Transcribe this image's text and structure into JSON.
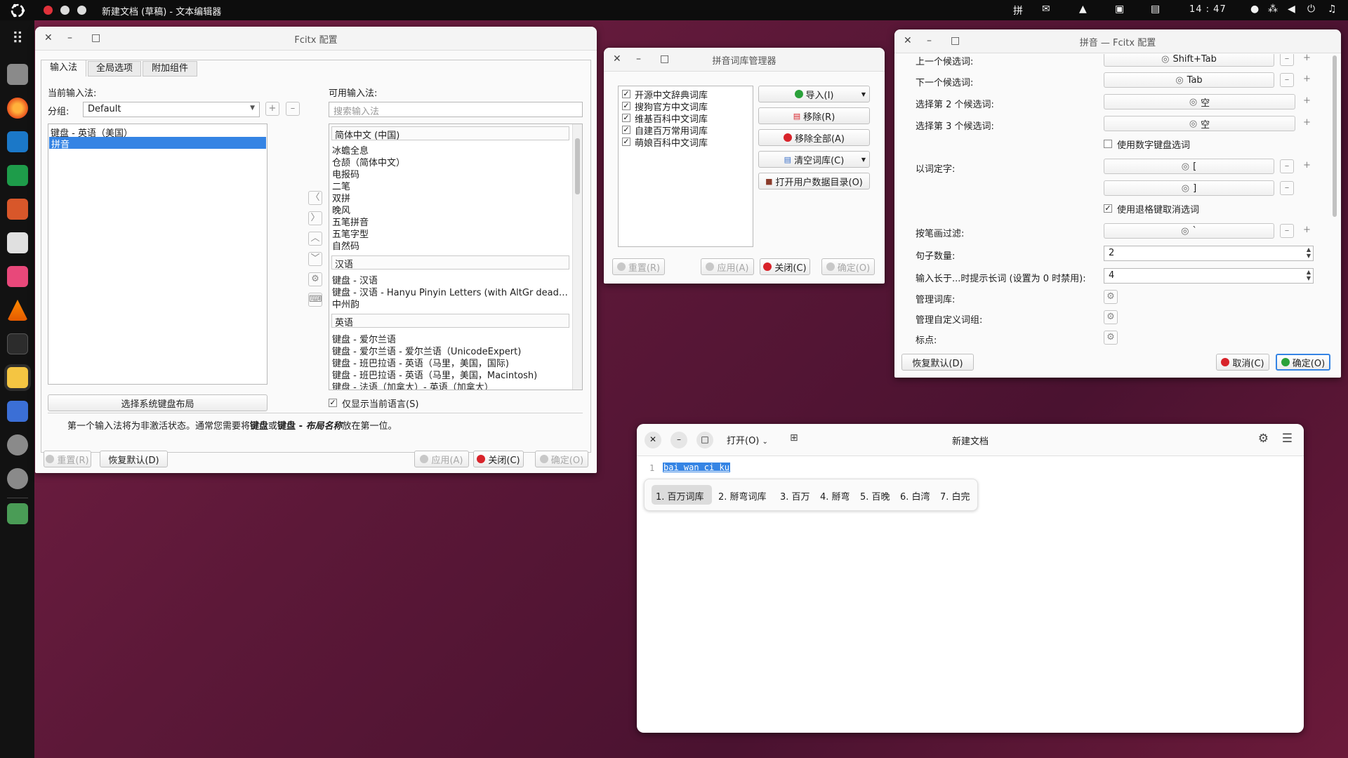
{
  "topbar": {
    "title": "新建文档 (草稿) - 文本编辑器",
    "indicator_ime": "拼",
    "clock": "14 : 47"
  },
  "dock": {
    "apps": [
      "files",
      "firefox",
      "writer",
      "calc",
      "impress",
      "software",
      "installer",
      "vlc",
      "terminal",
      "text-editor",
      "screenshot",
      "settings",
      "settings",
      "trash"
    ]
  },
  "fcitx": {
    "title": "Fcitx 配置",
    "tabs": [
      "输入法",
      "全局选项",
      "附加组件"
    ],
    "current_label": "当前输入法:",
    "group_label": "分组:",
    "group_value": "Default",
    "current_items": [
      "键盘 - 英语（美国）",
      "拼音"
    ],
    "available_label": "可用输入法:",
    "search_placeholder": "搜索输入法",
    "groups": [
      {
        "name": "简体中文 (中国)",
        "items": [
          "冰蟾全息",
          "仓颉（简体中文）",
          "电报码",
          "二笔",
          "双拼",
          "晚风",
          "五笔拼音",
          "五笔字型",
          "自然码"
        ]
      },
      {
        "name": "汉语",
        "items": [
          "键盘 - 汉语",
          "键盘 - 汉语 - Hanyu Pinyin Letters (with AltGr dead…",
          "中州韵"
        ]
      },
      {
        "name": "英语",
        "items": [
          "键盘 - 爱尔兰语",
          "键盘 - 爱尔兰语 - 爱尔兰语（UnicodeExpert)",
          "键盘 - 班巴拉语 - 英语（马里，美国，国际)",
          "键盘 - 班巴拉语 - 英语（马里，美国，Macintosh)",
          "键盘 - 法语（加拿大）- 英语（加拿大）"
        ]
      }
    ],
    "select_layout_btn": "选择系统键盘布局",
    "only_current_lang": "仅显示当前语言(S)",
    "hint_prefix": "第一个输入法将为非激活状态。通常您需要将",
    "hint_bold1": "键盘",
    "hint_mid": "或",
    "hint_bold2": "键盘 - ",
    "hint_italic": "布局名称",
    "hint_suffix": "放在第一位。",
    "btn_reset": "重置(R)",
    "btn_restore": "恢复默认(D)",
    "btn_apply": "应用(A)",
    "btn_close": "关闭(C)",
    "btn_ok": "确定(O)"
  },
  "dict": {
    "title": "拼音词库管理器",
    "items": [
      "开源中文辞典词库",
      "搜狗官方中文词库",
      "维基百科中文词库",
      "自建百万常用词库",
      "萌娘百科中文词库"
    ],
    "btn_import": "导入(I)",
    "btn_remove": "移除(R)",
    "btn_remove_all": "移除全部(A)",
    "btn_clear": "清空词库(C)",
    "btn_open_dir": "打开用户数据目录(O)",
    "btn_reset": "重置(R)",
    "btn_apply": "应用(A)",
    "btn_close": "关闭(C)",
    "btn_ok": "确定(O)"
  },
  "pinyin": {
    "title": "拼音 — Fcitx 配置",
    "rows": [
      {
        "label": "上一个候选词:",
        "value": "Shift+Tab"
      },
      {
        "label": "下一个候选词:",
        "value": "Tab"
      },
      {
        "label": "选择第 2 个候选词:",
        "value": "空"
      },
      {
        "label": "选择第 3 个候选词:",
        "value": "空"
      }
    ],
    "numpad_label": "使用数字键盘选词",
    "word_select_label": "以词定字:",
    "word_select_1": "[",
    "word_select_2": "]",
    "backspace_label": "使用退格键取消选词",
    "stroke_label": "按笔画过滤:",
    "stroke_value": "`",
    "sentence_label": "句子数量:",
    "sentence_value": "2",
    "longword_label": "输入长于...时提示长词 (设置为 0 时禁用):",
    "longword_value": "4",
    "manage_dict_label": "管理词库:",
    "manage_phrase_label": "管理自定义词组:",
    "punct_label": "标点:",
    "btn_restore": "恢复默认(D)",
    "btn_cancel": "取消(C)",
    "btn_ok": "确定(O)"
  },
  "editor": {
    "title": "新建文档",
    "open_label": "打开(O)",
    "line_no": "1",
    "preedit": "bai wan ci ku",
    "candidates": [
      "1. 百万词库",
      "2. 掰弯词库",
      "3. 百万",
      "4. 掰弯",
      "5. 百晚",
      "6. 白湾",
      "7. 白完"
    ]
  },
  "colors": {
    "selection": "#3584e4",
    "accent_red": "#d8232a",
    "accent_green": "#2aa13a",
    "wallpaper": "#6b1a3a"
  }
}
